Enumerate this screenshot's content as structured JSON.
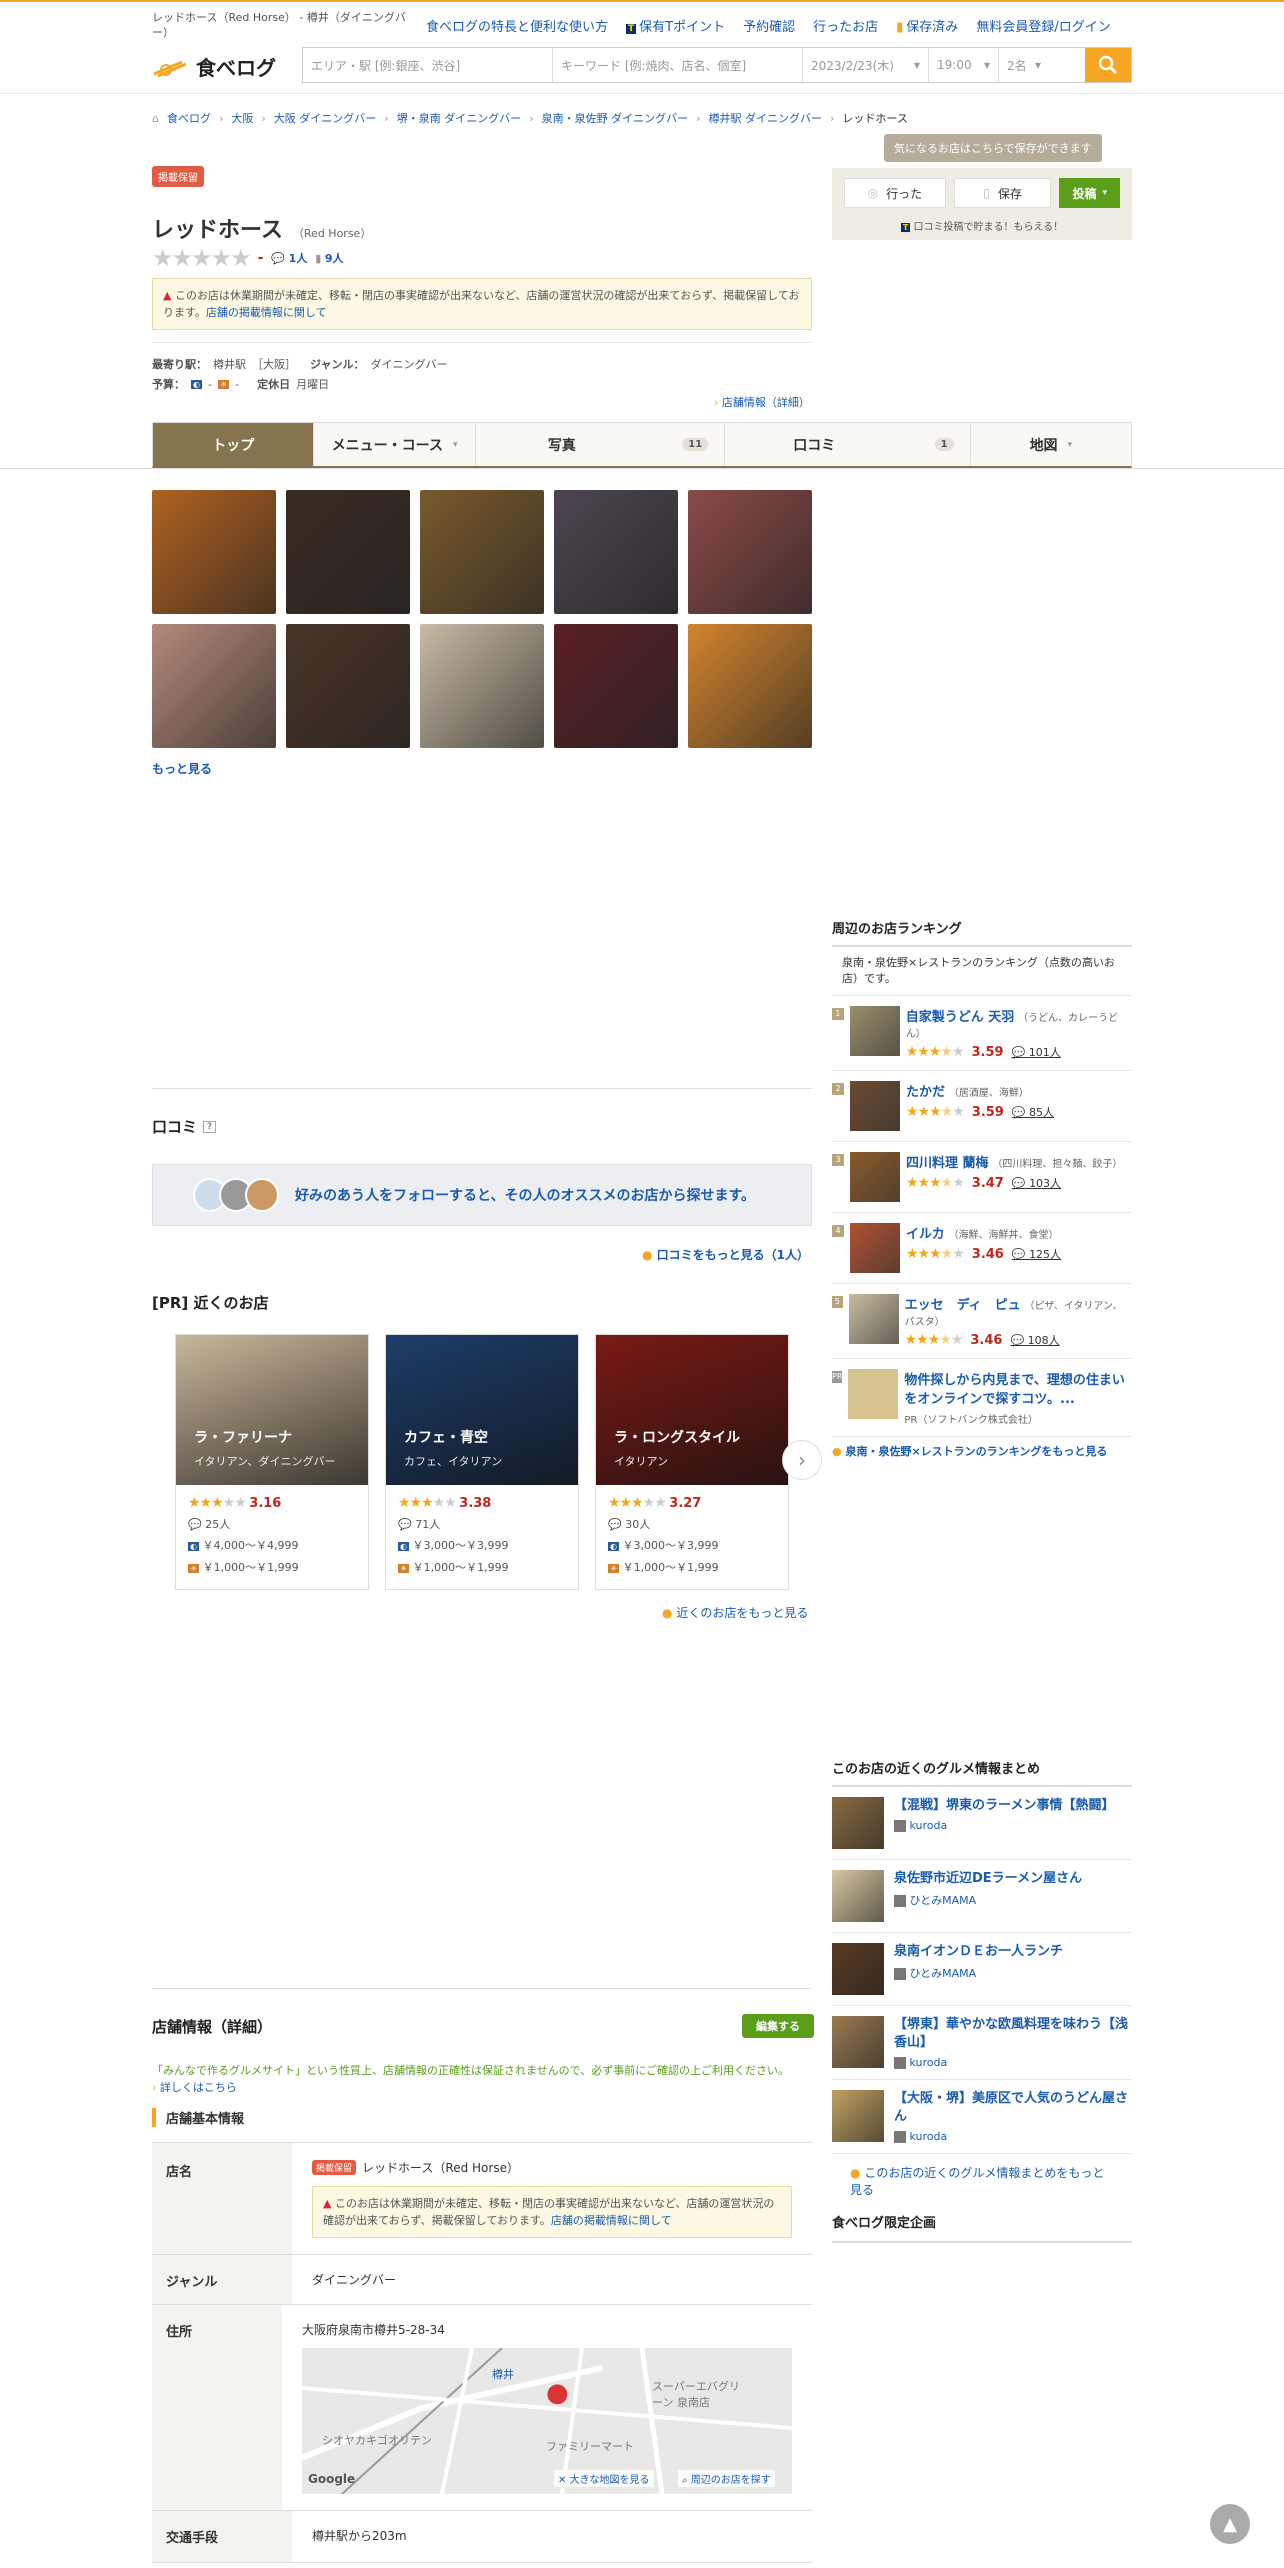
{
  "header": {
    "page_title": "レッドホース（Red Horse） - 樽井（ダイニングバー）",
    "links": [
      "食べログの特長と便利な使い方",
      "保有Tポイント",
      "予約確認",
      "行ったお店",
      "保存済み",
      "無料会員登録/ログイン"
    ],
    "logo_text": "食べログ",
    "search_area_placeholder": "エリア・駅 [例:銀座、渋谷]",
    "search_keyword_placeholder": "キーワード [例:焼肉、店名、個室]",
    "search_date": "2023/2/23(木)",
    "search_time": "19:00",
    "search_people": "2名"
  },
  "breadcrumb": [
    "食べログ",
    "大阪",
    "大阪 ダイニングバー",
    "堺・泉南 ダイニングバー",
    "泉南・泉佐野 ダイニングバー",
    "樽井駅 ダイニングバー",
    "レッドホース"
  ],
  "restaurant": {
    "status_badge": "掲載保留",
    "name": "レッドホース",
    "name_en": "（Red Horse）",
    "rating": "-",
    "review_count": "1人",
    "save_count": "9人",
    "warning": "このお店は休業期間が未確定、移転・閉店の事実確認が出来ないなど、店舗の運営状況の確認が出来ておらず、掲載保留しております。",
    "warning_link": "店舗の掲載情報に関して",
    "station_label": "最寄り駅：",
    "station": "樽井駅",
    "station_area": "［大阪］",
    "genre_label": "ジャンル：",
    "genre": "ダイニングバー",
    "budget_label": "予算：",
    "budget_dinner": "-",
    "budget_lunch": "-",
    "holiday_label": "定休日",
    "holiday": "月曜日",
    "info_link": "店舗情報（詳細）"
  },
  "save_box": {
    "tooltip": "気になるお店はこちらで保存ができます",
    "went": "行った",
    "save": "保存",
    "post": "投稿",
    "tpoint": "口コミ投稿で貯まる！もらえる！"
  },
  "tabs": [
    {
      "label": "トップ",
      "count": ""
    },
    {
      "label": "メニュー・コース",
      "count": ""
    },
    {
      "label": "写真",
      "count": "11"
    },
    {
      "label": "口コミ",
      "count": "1"
    },
    {
      "label": "地図",
      "count": ""
    }
  ],
  "photos": {
    "more": "もっと見る",
    "colors": [
      "#b0621f",
      "#3a2b22",
      "#7a5a2c",
      "#4d4550",
      "#8a4a48",
      "#b58a7a",
      "#4a3426",
      "#c8bba4",
      "#5a2024",
      "#d2852d"
    ]
  },
  "reviews": {
    "title": "口コミ",
    "follow_text": "好みのあう人をフォローすると、その人のオススメのお店から探せます。",
    "more": "口コミをもっと見る（1人）"
  },
  "nearby": {
    "title": "[PR] 近くのお店",
    "more": "近くのお店をもっと見る",
    "cards": [
      {
        "name": "ラ・ファリーナ",
        "genre": "イタリアン、ダイニングバー",
        "score": "3.16",
        "stars": 3,
        "reviews": "25人",
        "dinner": "￥4,000～￥4,999",
        "lunch": "￥1,000～￥1,999",
        "color": "#c9b79a"
      },
      {
        "name": "カフェ・青空",
        "genre": "カフェ、イタリアン",
        "score": "3.38",
        "stars": 3,
        "reviews": "71人",
        "dinner": "￥3,000～￥3,999",
        "lunch": "￥1,000～￥1,999",
        "color": "#1c3d6a"
      },
      {
        "name": "ラ・ロングスタイル",
        "genre": "イタリアン",
        "score": "3.27",
        "stars": 3,
        "reviews": "30人",
        "dinner": "￥3,000～￥3,999",
        "lunch": "￥1,000～￥1,999",
        "color": "#7a1a14"
      }
    ]
  },
  "ranking": {
    "title": "周辺のお店ランキング",
    "desc": "泉南・泉佐野×レストランのランキング（点数の高いお店）です。",
    "items": [
      {
        "no": "1",
        "name": "自家製うどん 天羽",
        "sub": "（うどん、カレーうどん）",
        "score": "3.59",
        "reviews": "101人",
        "color": "#9a8f6a"
      },
      {
        "no": "2",
        "name": "たかだ",
        "sub": "（居酒屋、海鮮）",
        "score": "3.59",
        "reviews": "85人",
        "color": "#6b4a30"
      },
      {
        "no": "3",
        "name": "四川料理 蘭梅",
        "sub": "（四川料理、担々麺、餃子）",
        "score": "3.47",
        "reviews": "103人",
        "color": "#8a5a2a"
      },
      {
        "no": "4",
        "name": "イルカ",
        "sub": "（海鮮、海鮮丼、食堂）",
        "score": "3.46",
        "reviews": "125人",
        "color": "#b05030"
      },
      {
        "no": "5",
        "name": "エッセ　ディ　ピュ",
        "sub": "（ピザ、イタリアン、パスタ）",
        "score": "3.46",
        "reviews": "108人",
        "color": "#c8bca0"
      }
    ],
    "pr_title": "物件探しから内見まで、理想の住まいをオンラインで探すコツ。...",
    "pr_sub": "PR（ソフトバンク株式会社）",
    "more": "泉南・泉佐野×レストランのランキングをもっと見る"
  },
  "gourmet": {
    "title": "このお店の近くのグルメ情報まとめ",
    "items": [
      {
        "title": "【混戦】堺東のラーメン事情【熱闘】",
        "user": "kuroda",
        "color": "#8a6a40"
      },
      {
        "title": "泉佐野市近辺DEラーメン屋さん",
        "user": "ひとみMAMA",
        "color": "#d8c8a0"
      },
      {
        "title": "泉南イオンＤＥお一人ランチ",
        "user": "ひとみMAMA",
        "color": "#5a3a20"
      },
      {
        "title": "【堺東】華やかな欧風料理を味わう【浅香山】",
        "user": "kuroda",
        "color": "#9a7a50"
      },
      {
        "title": "【大阪・堺】美原区で人気のうどん屋さん",
        "user": "kuroda",
        "color": "#c0a060"
      }
    ],
    "more": "このお店の近くのグルメ情報まとめをもっと見る",
    "limited": "食べログ限定企画"
  },
  "store_info": {
    "title": "店舗情報（詳細）",
    "edit": "編集する",
    "notice": "「みんなで作るグルメサイト」という性質上、店舗情報の正確性は保証されませんので、必ず事前にご確認の上ご利用ください。",
    "notice_link": "詳しくはこちら",
    "basic_title": "店舗基本情報",
    "rows": {
      "name_th": "店名",
      "name_val": "レッドホース（Red Horse）",
      "genre_th": "ジャンル",
      "genre_val": "ダイニングバー",
      "address_th": "住所",
      "address_val": "大阪府泉南市樽井5-28-34",
      "access_th": "交通手段",
      "access_val": "樽井駅から203m"
    },
    "map": {
      "station": "樽井",
      "store1": "スーパーエバグリーン 泉南店",
      "store2": "ファミリーマート",
      "store3": "シオヤカキゴオリテン",
      "big_map": "大きな地図を見る",
      "nearby": "周辺のお店を探す",
      "google": "Google"
    }
  }
}
